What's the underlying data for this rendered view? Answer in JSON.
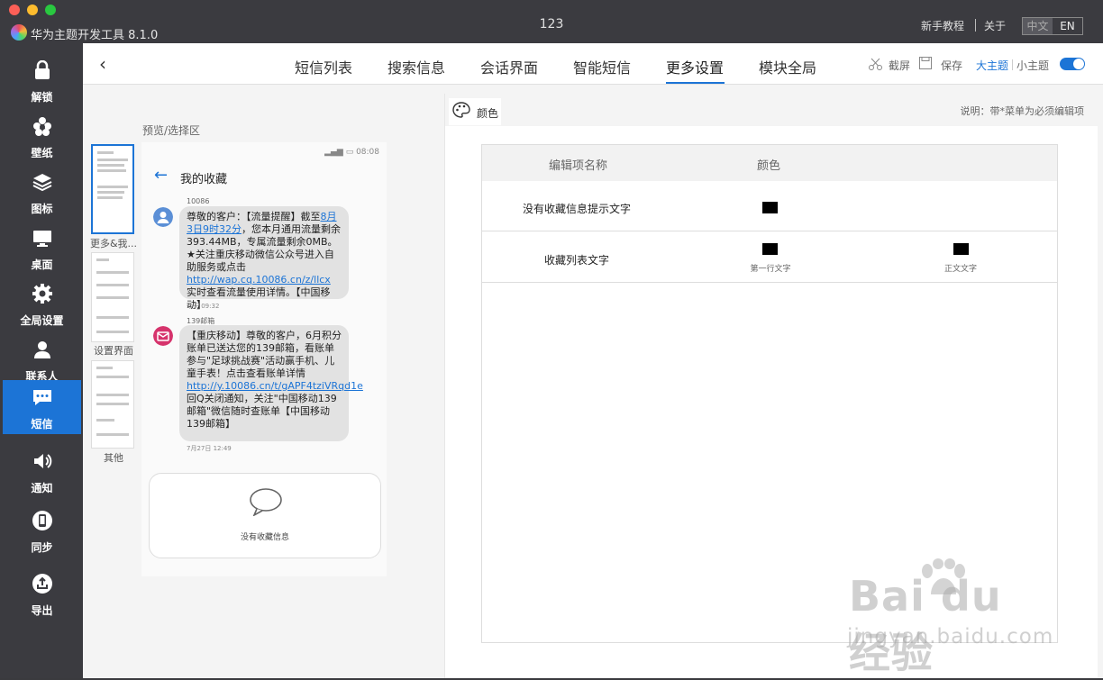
{
  "window": {
    "title": "123",
    "app_title": "华为主题开发工具 8.1.0"
  },
  "top_links": {
    "tutorial": "新手教程",
    "about": "关于"
  },
  "language": {
    "zh": "中文",
    "en": "EN"
  },
  "sidebar": {
    "items": [
      {
        "label": "解锁",
        "icon": "lock-icon"
      },
      {
        "label": "壁纸",
        "icon": "flower-icon"
      },
      {
        "label": "图标",
        "icon": "layers-icon"
      },
      {
        "label": "桌面",
        "icon": "monitor-icon"
      },
      {
        "label": "全局设置",
        "icon": "gear-icon"
      },
      {
        "label": "联系人",
        "icon": "person-icon"
      },
      {
        "label": "短信",
        "icon": "message-icon",
        "active": true
      },
      {
        "label": "通知",
        "icon": "speaker-icon"
      },
      {
        "label": "同步",
        "icon": "phone-icon"
      },
      {
        "label": "导出",
        "icon": "upload-icon"
      }
    ]
  },
  "nav": {
    "tabs": [
      {
        "label": "短信列表"
      },
      {
        "label": "搜索信息"
      },
      {
        "label": "会话界面"
      },
      {
        "label": "智能短信"
      },
      {
        "label": "更多设置",
        "active": true
      },
      {
        "label": "模块全局"
      }
    ],
    "tools": {
      "screenshot": "截屏",
      "save": "保存",
      "big_theme": "大主题",
      "small_theme": "小主题"
    }
  },
  "preview": {
    "label": "预览/选择区",
    "thumbs": [
      {
        "caption": "更多&我..."
      },
      {
        "caption": "设置界面"
      },
      {
        "caption": "其他"
      }
    ]
  },
  "phone": {
    "status_time": "08:08",
    "title": "我的收藏",
    "messages": [
      {
        "sender": "10086",
        "parts": [
          "尊敬的客户：【流量提醒】截至",
          "8月3日9时32分",
          "，您本月通用流量剩余393.44MB，专属流量剩余0MB。★关注重庆移动微信公众号进入自助服务或点击",
          "http://wap.cq.10086.cn/z/llcx",
          " 实时查看流量使用详情。【中国移动】"
        ],
        "time": "今天 09:32"
      },
      {
        "sender": "139邮箱",
        "parts": [
          "【重庆移动】尊敬的客户，6月积分账单已送达您的139邮箱，看账单参与\"足球挑战赛\"活动赢手机、儿童手表！点击查看账单详情 ",
          "http://y.10086.cn/t/gAPF4tziVRqd1e",
          " 回Q关闭通知，关注\"中国移动139邮箱\"微信随时查账单【中国移动139邮箱】"
        ],
        "time": "7月27日 12:49"
      }
    ],
    "empty_text": "没有收藏信息"
  },
  "panel": {
    "tab_label": "颜色",
    "note": "说明：带*菜单为必须编辑项",
    "headers": {
      "name": "编辑项名称",
      "color": "颜色"
    },
    "rows": [
      {
        "name": "没有收藏信息提示文字",
        "swatches": [
          {
            "color": "#000000",
            "caption": ""
          }
        ]
      },
      {
        "name": "收藏列表文字",
        "swatches": [
          {
            "color": "#000000",
            "caption": "第一行文字"
          },
          {
            "color": "#000000",
            "caption": "正文文字"
          }
        ]
      }
    ]
  },
  "watermark": {
    "logo_text": "Bai du 经验",
    "url": "jingyan.baidu.com"
  }
}
